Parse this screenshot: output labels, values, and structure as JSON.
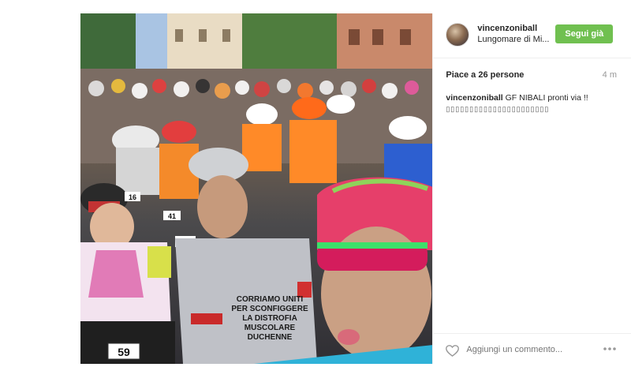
{
  "post": {
    "username": "vincenzoniball",
    "location": "Lungomare di Mi...",
    "follow_label": "Segui già",
    "likes": "Piace a 26 persone",
    "time": "4 m",
    "caption_user": "vincenzoniball",
    "caption_text": "GF NIBALI pronti via !!",
    "caption_emoji": "▯▯▯▯▯▯▯▯▯▯▯▯▯▯▯▯▯▯▯▯▯▯",
    "comment_placeholder": "Aggiungi un commento...",
    "photo_text": {
      "number_59": "59",
      "number_36": "36",
      "number_41": "41",
      "number_16": "16",
      "shirt_line1": "CORRIAMO UNITI",
      "shirt_line2": "PER SCONFIGGERE",
      "shirt_line3": "LA DISTROFIA",
      "shirt_line4": "MUSCOLARE",
      "shirt_line5": "DUCHENNE"
    }
  },
  "colors": {
    "follow_green": "#70c050",
    "text_dark": "#262626",
    "text_muted": "#999999",
    "divider": "#efefef"
  },
  "icons": {
    "heart": "heart-icon",
    "more": "more-icon",
    "avatar": "avatar"
  }
}
